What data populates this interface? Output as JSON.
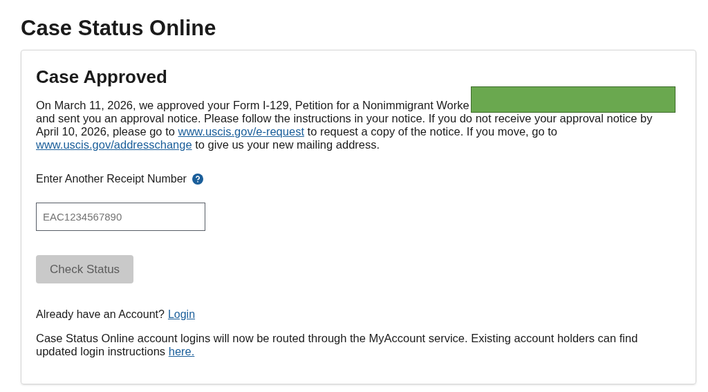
{
  "page_title": "Case Status Online",
  "case": {
    "heading": "Case Approved",
    "lines": [
      [
        {
          "kind": "text",
          "text": "On March 11, 2026, we approved your Form I-129, Petition for a Nonimmigrant Worke"
        }
      ],
      [
        {
          "kind": "text",
          "text": "and sent you an approval notice. Please follow the instructions in your notice. If you do not receive your approval notice by"
        }
      ],
      [
        {
          "kind": "text",
          "text": "April 10, 2026, please go to "
        },
        {
          "kind": "link",
          "text": "www.uscis.gov/e-request"
        },
        {
          "kind": "text",
          "text": " to request a copy of the notice. If you move, go to"
        }
      ],
      [
        {
          "kind": "link",
          "text": "www.uscis.gov/addresschange"
        },
        {
          "kind": "text",
          "text": " to give us your new mailing address."
        }
      ]
    ],
    "redacted": true
  },
  "receipt": {
    "label": "Enter Another Receipt Number",
    "placeholder": "EAC1234567890"
  },
  "button": {
    "label": "Check Status",
    "disabled": true
  },
  "account": {
    "prompt": "Already have an Account?",
    "link": "Login"
  },
  "notice": [
    {
      "kind": "text",
      "text": "Case Status Online account logins will now be routed through the MyAccount service. Existing account holders can find updated login instructions "
    },
    {
      "kind": "link",
      "text": "here."
    }
  ]
}
